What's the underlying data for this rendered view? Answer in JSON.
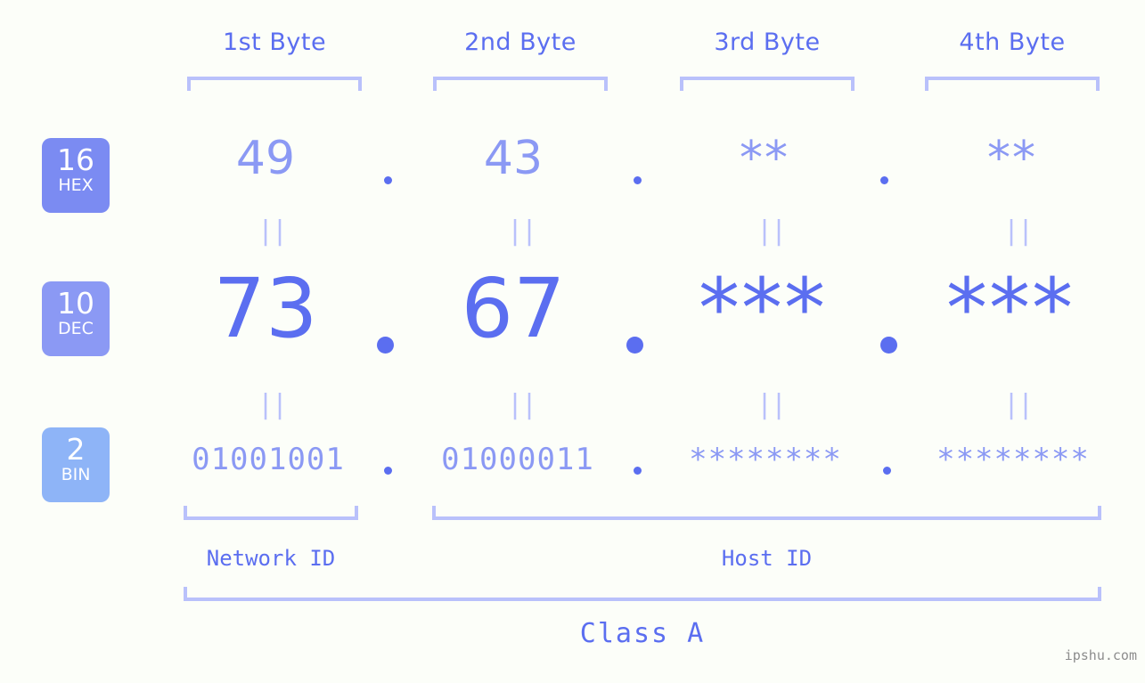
{
  "background_color": "#fcfef9",
  "accent_color": "#5b6ef0",
  "accent_light": "#8b99f4",
  "rail_color": "#b9c1fb",
  "header": {
    "byte_labels": [
      "1st Byte",
      "2nd Byte",
      "3rd Byte",
      "4th Byte"
    ]
  },
  "bases": [
    {
      "number": "16",
      "name": "HEX",
      "color": "#7b8bf2"
    },
    {
      "number": "10",
      "name": "DEC",
      "color": "#8b99f4"
    },
    {
      "number": "2",
      "name": "BIN",
      "color": "#8eb4f7"
    }
  ],
  "rows": {
    "hex": {
      "base": "16",
      "base_name": "HEX",
      "values": [
        "49",
        "43",
        "**",
        "**"
      ],
      "separator": "."
    },
    "dec": {
      "base": "10",
      "base_name": "DEC",
      "values": [
        "73",
        "67",
        "***",
        "***"
      ],
      "separator": "."
    },
    "bin": {
      "base": "2",
      "base_name": "BIN",
      "values": [
        "01001001",
        "01000011",
        "********",
        "********"
      ],
      "separator": "."
    }
  },
  "equality_marks": {
    "glyph": "||",
    "count_per_row": 4,
    "rows": 2
  },
  "footer": {
    "network_id_label": "Network ID",
    "host_id_label": "Host ID",
    "class_label": "Class A"
  },
  "watermark": "ipshu.com",
  "ip_address": {
    "hex": "49.43.**.**",
    "dec": "73.67.***.***",
    "bin": "01001001.01000011.********.********"
  }
}
